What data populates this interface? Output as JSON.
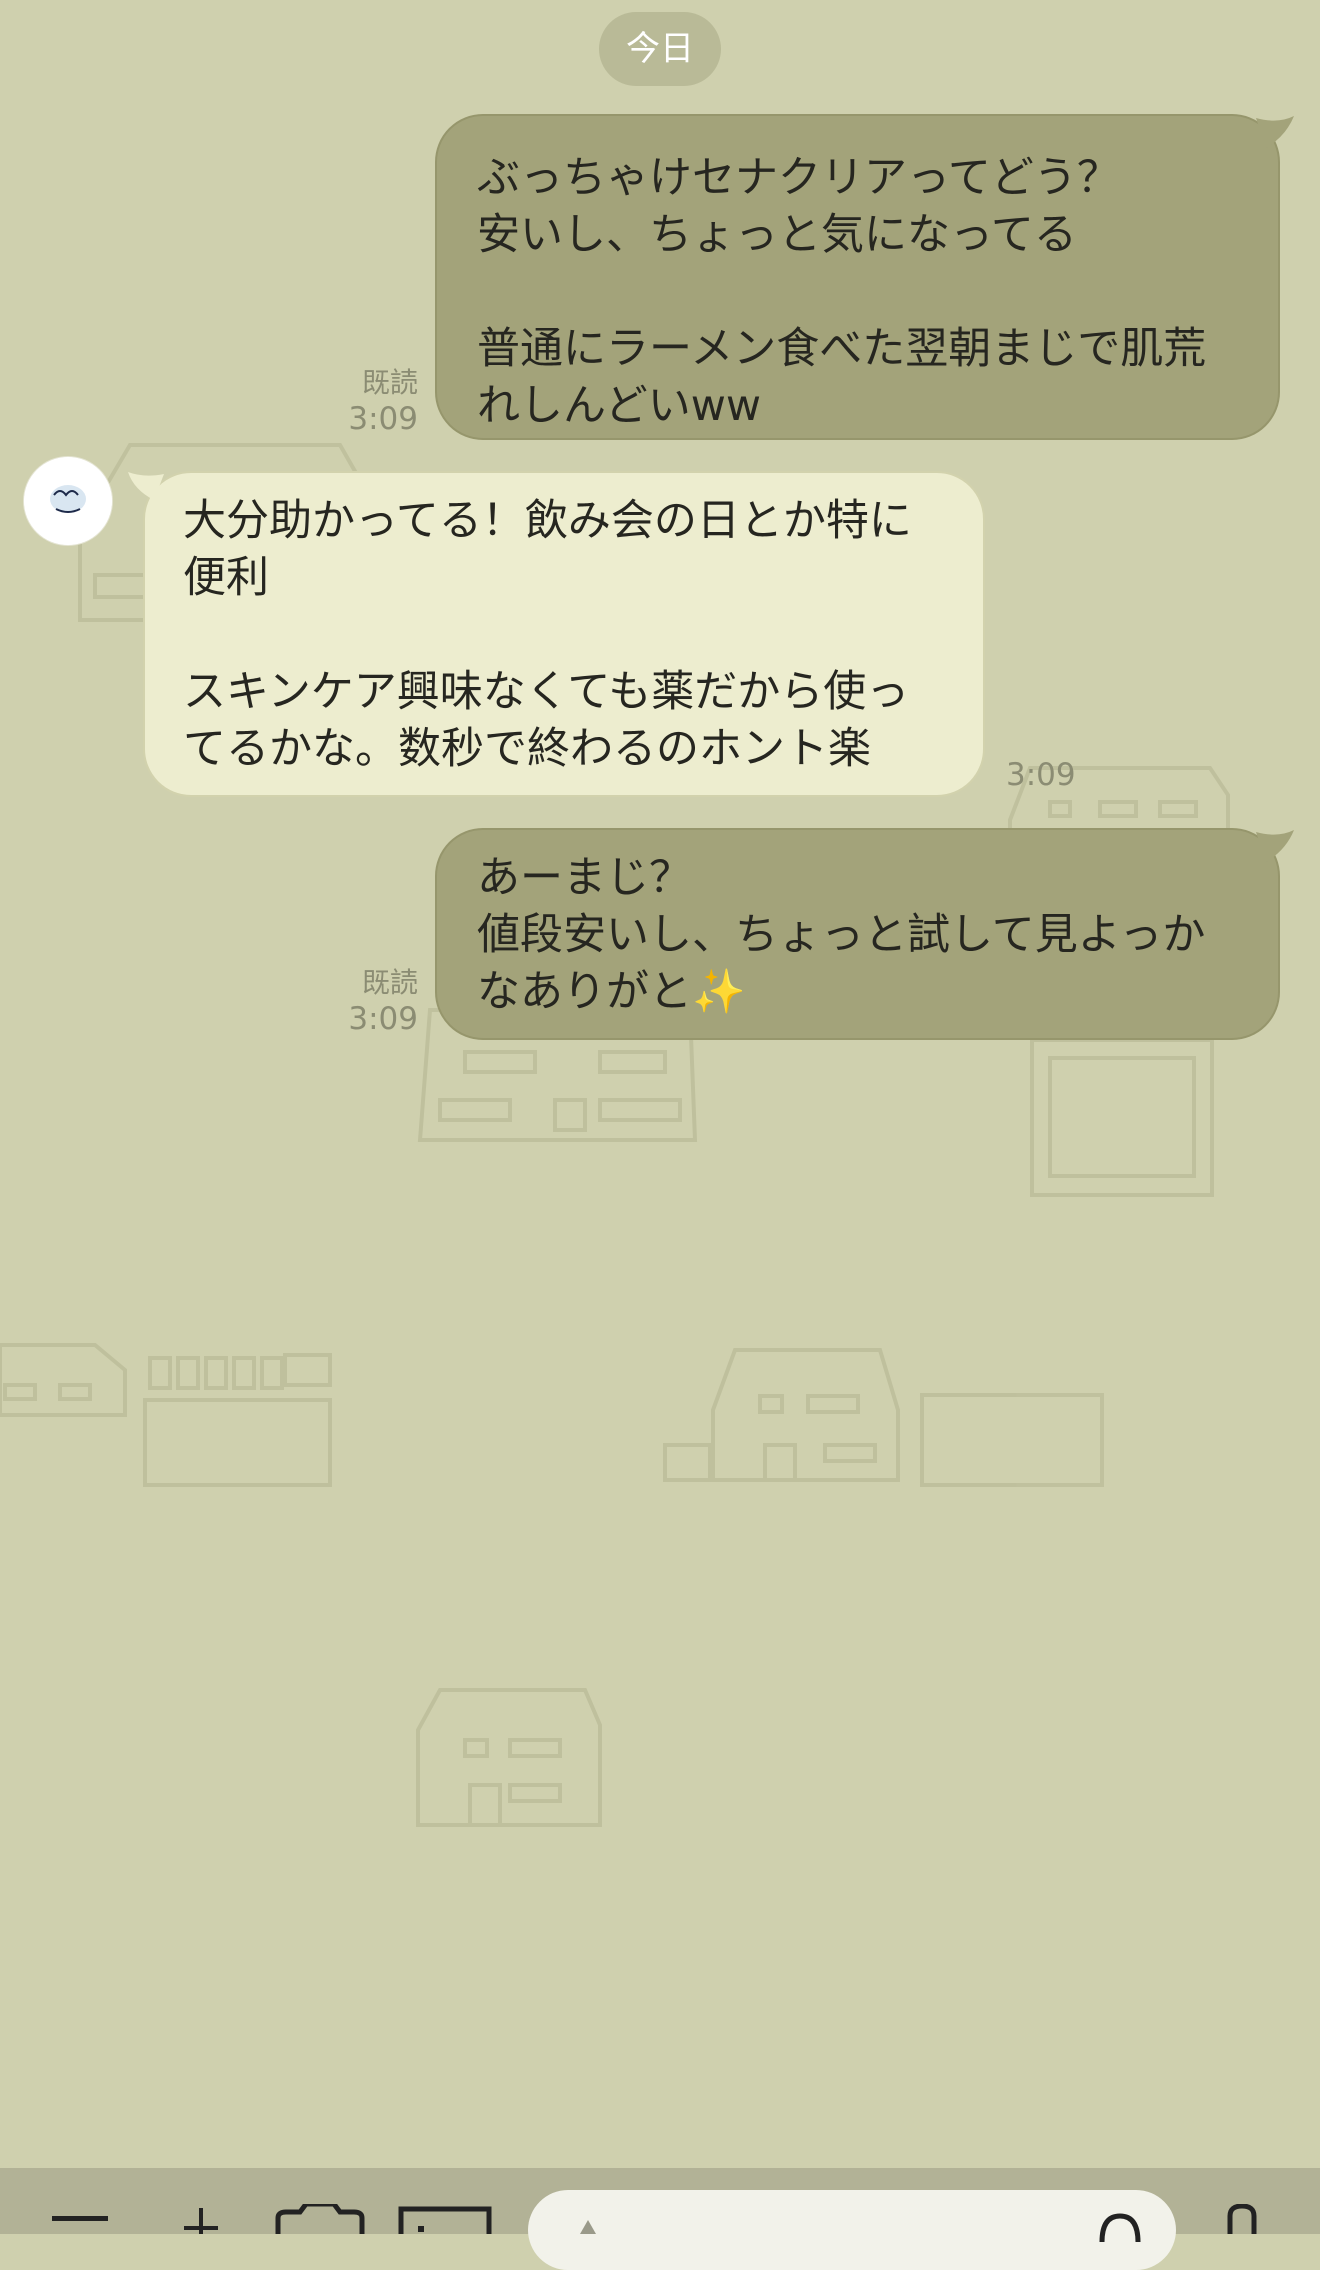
{
  "chat": {
    "date_label": "今日",
    "messages": [
      {
        "side": "sent",
        "text": "ぶっちゃけセナクリアってどう？\n安いし、ちょっと気になってる\n\n普通にラーメン食べた翌朝まじで肌荒れしんどいww",
        "read_label": "既読",
        "time": "3:09"
      },
      {
        "side": "received",
        "text": "大分助かってる！飲み会の日とか特に便利\n\nスキンケア興味なくても薬だから使ってるかな。数秒で終わるのホント楽",
        "time": "3:09"
      },
      {
        "side": "sent",
        "text": "あーまじ？\n値段安いし、ちょっと試して見よっかなありがと✨",
        "read_label": "既読",
        "time": "3:09"
      }
    ]
  },
  "icons": {
    "menu": "menu-icon",
    "add": "plus-icon",
    "camera": "camera-icon",
    "image": "image-icon",
    "emoji": "emoji-icon",
    "mic": "microphone-icon"
  },
  "colors": {
    "background": "#cfd0ae",
    "sent_bubble": "#a3a37a",
    "received_bubble": "#ededcf",
    "toolbar": "#b2b296"
  }
}
